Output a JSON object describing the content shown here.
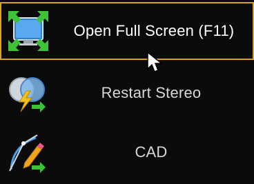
{
  "menu": {
    "items": [
      {
        "label": "Open Full Screen (F11)",
        "icon": "fullscreen-icon",
        "highlighted": true
      },
      {
        "label": "Restart Stereo",
        "icon": "restart-stereo-icon",
        "highlighted": false
      },
      {
        "label": "CAD",
        "icon": "cad-icon",
        "highlighted": false
      }
    ],
    "highlight_color": "#d9a220"
  }
}
